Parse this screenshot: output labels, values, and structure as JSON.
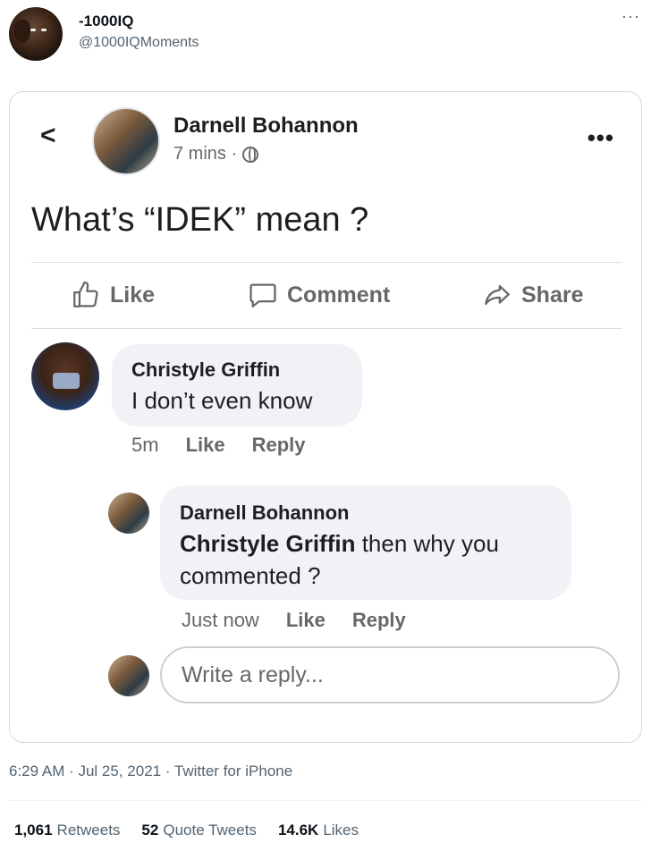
{
  "tweet": {
    "display_name": "-1000IQ",
    "handle": "@1000IQMoments",
    "more_icon": "ellipsis-icon",
    "timestamp": "6:29 AM · Jul 25, 2021 · Twitter for iPhone",
    "stats": [
      {
        "count": "1,061",
        "label": "Retweets"
      },
      {
        "count": "52",
        "label": "Quote Tweets"
      },
      {
        "count": "14.6K",
        "label": "Likes"
      }
    ]
  },
  "fb_post": {
    "author": "Darnell Bohannon",
    "time": "7 mins ·",
    "text": "What’s “IDEK” mean ?",
    "actions": {
      "like": "Like",
      "comment": "Comment",
      "share": "Share"
    },
    "comments": [
      {
        "author": "Christyle Griffin",
        "text": "I don’t even know",
        "time": "5m",
        "like": "Like",
        "reply": "Reply"
      }
    ],
    "reply": {
      "author": "Darnell Bohannon",
      "mention": "Christyle Griffin",
      "line1_rest": " then why you",
      "line2": "commented ?",
      "time": "Just now",
      "like": "Like",
      "reply": "Reply"
    },
    "reply_placeholder": "Write a reply..."
  },
  "colors": {
    "fb_text": "#1c1e21",
    "fb_gray": "#65676b",
    "bubble": "#f0f2f5",
    "twitter_gray": "#536471"
  }
}
